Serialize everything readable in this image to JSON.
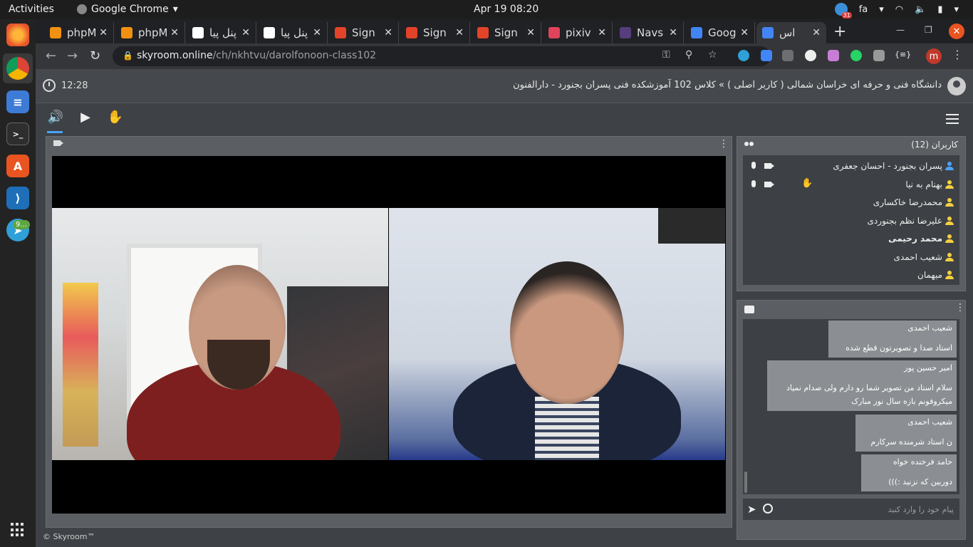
{
  "system": {
    "activities": "Activities",
    "app_name": "Google Chrome",
    "clock": "Apr 19  08:20",
    "lang": "fa",
    "cal_badge": "31"
  },
  "dock": {
    "badge": "9..."
  },
  "browser": {
    "tabs": [
      {
        "label": "phpM",
        "color": "#f29111"
      },
      {
        "label": "phpM",
        "color": "#f29111"
      },
      {
        "label": "پنل پیا",
        "color": "#ffffff"
      },
      {
        "label": "پنل پیا",
        "color": "#ffffff"
      },
      {
        "label": "Sign",
        "color": "#e24329"
      },
      {
        "label": "Sign",
        "color": "#e24329"
      },
      {
        "label": "Sign",
        "color": "#e24329"
      },
      {
        "label": "pixiv",
        "color": "#e0435c"
      },
      {
        "label": "Navs",
        "color": "#563d7c"
      },
      {
        "label": "Goog",
        "color": "#4285f4"
      },
      {
        "label": "اس",
        "color": "#4285f4"
      }
    ],
    "url_host": "skyroom.online",
    "url_path": "/ch/nkhtvu/darolfonoon-class102"
  },
  "page": {
    "class_time": "12:28",
    "breadcrumb": "دانشگاه فنی و حرفه ای خراسان شمالی ( کاربر اصلی ) » کلاس 102 آموزشکده فنی پسران بجنورد - دارالفنون",
    "users_title": "کاربران (12)",
    "users": [
      {
        "name": "پسران بجنورد - احسان جعفری",
        "color": "#4aa3ff",
        "bold": false
      },
      {
        "name": "بهنام به نیا",
        "color": "#f4d03f",
        "bold": false
      },
      {
        "name": "محمدرضا خاکساری",
        "color": "#f4d03f",
        "bold": false
      },
      {
        "name": "علیرضا نظم بجنوردی",
        "color": "#f4d03f",
        "bold": false
      },
      {
        "name": "محمد رحیمی",
        "color": "#f4d03f",
        "bold": true
      },
      {
        "name": "شعیب احمدی",
        "color": "#f4d03f",
        "bold": false
      },
      {
        "name": "میهمان",
        "color": "#f4d03f",
        "bold": false
      }
    ],
    "messages": [
      {
        "author": "شعیب احمدی",
        "lines": [
          "استاد صدا و تصویرتون قطع شده"
        ]
      },
      {
        "author": "امیر حسین پور",
        "lines": [
          "سلام استاد من تصویر شما رو دارم ولی صدام نمیاد",
          "میکروفونم بازه سال نور مبارک"
        ]
      },
      {
        "author": "شعیب احمدی",
        "lines": [
          "ن استاد شرمنده سرکارم"
        ]
      },
      {
        "author": "حامد فرخنده خواه",
        "lines": [
          "دوربین که نزنید :)))"
        ]
      }
    ],
    "chat_placeholder": "پیام خود را وارد کنید",
    "footer": "© Skyroom™"
  }
}
